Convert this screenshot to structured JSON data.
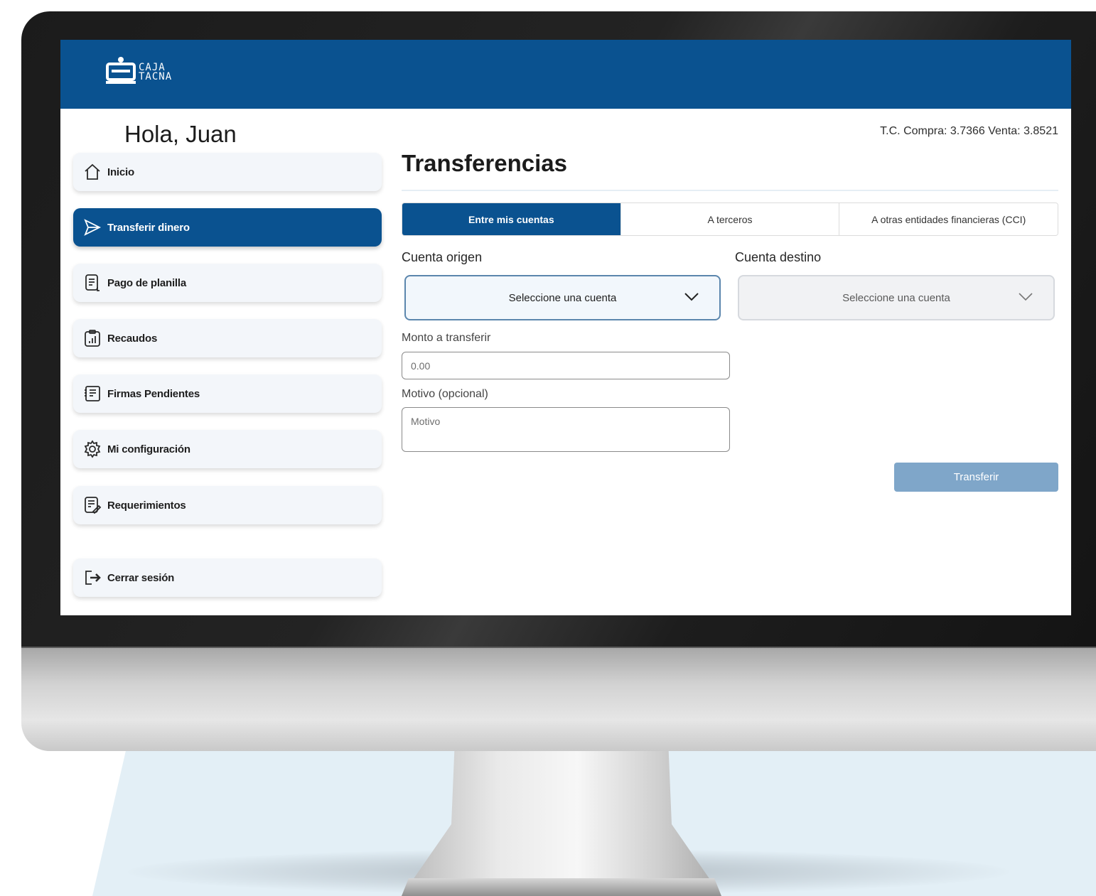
{
  "brand": {
    "logo_line1": "CAJA",
    "logo_line2": "TACNA",
    "primary_color": "#0a5290"
  },
  "greeting": "Hola, Juan",
  "exchange_rate": "T.C. Compra: 3.7366 Venta: 3.8521",
  "sidebar": {
    "items": [
      {
        "label": "Inicio",
        "icon": "home-icon"
      },
      {
        "label": "Transferir dinero",
        "icon": "send-icon",
        "active": true
      },
      {
        "label": "Pago de planilla",
        "icon": "document-icon"
      },
      {
        "label": "Recaudos",
        "icon": "clipboard-chart-icon"
      },
      {
        "label": "Firmas Pendientes",
        "icon": "checklist-icon"
      },
      {
        "label": "Mi configuración",
        "icon": "gear-icon"
      },
      {
        "label": "Requerimientos",
        "icon": "document-edit-icon"
      }
    ],
    "logout": {
      "label": "Cerrar sesión",
      "icon": "logout-icon"
    }
  },
  "main": {
    "title": "Transferencias",
    "tabs": [
      {
        "label": "Entre mis cuentas",
        "active": true
      },
      {
        "label": "A terceros"
      },
      {
        "label": "A otras entidades financieras (CCI)"
      }
    ],
    "form": {
      "origin_label": "Cuenta origen",
      "origin_value": "Seleccione una cuenta",
      "dest_label": "Cuenta destino",
      "dest_value": "Seleccione una cuenta",
      "amount_label": "Monto a transferir",
      "amount_placeholder": "0.00",
      "reason_label": "Motivo (opcional)",
      "reason_placeholder": "Motivo",
      "submit_label": "Transferir"
    }
  }
}
